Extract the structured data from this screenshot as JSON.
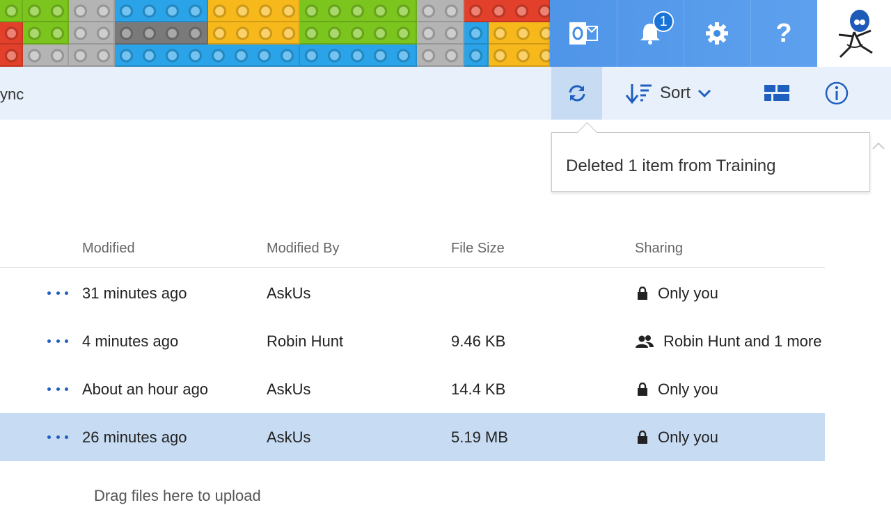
{
  "colors": {
    "accent": "#1f5fbf",
    "header_overlay": "#3f8ce4",
    "commandbar_bg": "#e8f1fb",
    "selected_row": "#c7dcf3",
    "lego_red": "#e2402a",
    "lego_green": "#7bc51e",
    "lego_gray": "#b4b4b4",
    "lego_darkgray": "#7a7a7a",
    "lego_blue": "#2aa3e8",
    "lego_yellow": "#f7b81c"
  },
  "header": {
    "icons": [
      "outlook-icon",
      "bell-icon",
      "gear-icon",
      "help-icon"
    ],
    "notification_count": "1",
    "help_label": "?"
  },
  "commandbar": {
    "left_fragment": "ync",
    "sort_label": "Sort"
  },
  "notification": {
    "message": "Deleted 1 item from Training"
  },
  "list": {
    "columns": [
      "Modified",
      "Modified By",
      "File Size",
      "Sharing"
    ],
    "rows": [
      {
        "modified": "31 minutes ago",
        "modified_by": "AskUs",
        "size": "",
        "sharing": "Only you",
        "share_icon": "lock-icon",
        "selected": false
      },
      {
        "modified": "4 minutes ago",
        "modified_by": "Robin Hunt",
        "size": "9.46 KB",
        "sharing": "Robin Hunt and 1 more",
        "share_icon": "people-icon",
        "selected": false
      },
      {
        "modified": "About an hour ago",
        "modified_by": "AskUs",
        "size": "14.4 KB",
        "sharing": "Only you",
        "share_icon": "lock-icon",
        "selected": false
      },
      {
        "modified": "26 minutes ago",
        "modified_by": "AskUs",
        "size": "5.19 MB",
        "sharing": "Only you",
        "share_icon": "lock-icon",
        "selected": true
      }
    ],
    "drag_hint": "Drag files here to upload"
  }
}
